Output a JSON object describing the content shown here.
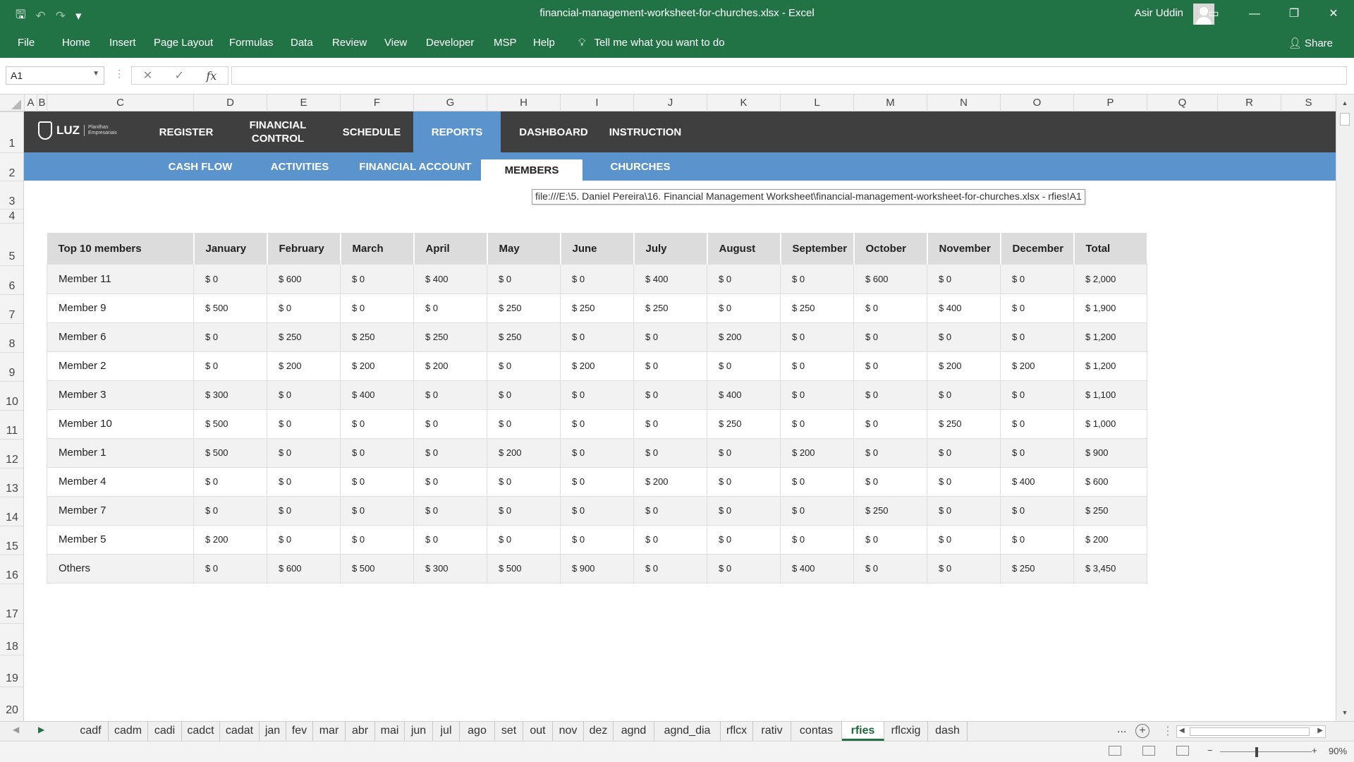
{
  "titlebar": {
    "title": "financial-management-worksheet-for-churches.xlsx  -  Excel",
    "user": "Asir Uddin",
    "qat": {
      "save": "🖫",
      "undo": "↶",
      "redo": "↷",
      "more": "▾"
    },
    "controls": {
      "ribbon_display": "▭",
      "minimize": "—",
      "restore": "❐",
      "close": "✕"
    }
  },
  "ribbon": {
    "tabs": [
      "File",
      "Home",
      "Insert",
      "Page Layout",
      "Formulas",
      "Data",
      "Review",
      "View",
      "Developer",
      "MSP",
      "Help"
    ],
    "tell_me": "Tell me what you want to do",
    "share": "Share"
  },
  "formula_bar": {
    "name_box": "A1",
    "formula": "",
    "cancel_icon": "✕",
    "enter_icon": "✓",
    "fx_label": "fx"
  },
  "columns": [
    "A",
    "B",
    "C",
    "D",
    "E",
    "F",
    "G",
    "H",
    "I",
    "J",
    "K",
    "L",
    "M",
    "N",
    "O",
    "P",
    "Q",
    "R",
    "S"
  ],
  "rows": [
    "1",
    "2",
    "3",
    "4",
    "5",
    "6",
    "7",
    "8",
    "9",
    "10",
    "11",
    "12",
    "13",
    "14",
    "15",
    "16",
    "17",
    "18",
    "19",
    "20"
  ],
  "nav": {
    "logo_brand": "LUZ",
    "logo_sub_1": "Planilhas",
    "logo_sub_2": "Empresariais",
    "items": [
      "REGISTER",
      "FINANCIAL\nCONTROL",
      "SCHEDULE",
      "REPORTS",
      "DASHBOARD",
      "INSTRUCTION"
    ],
    "active_item": "REPORTS",
    "subitems": [
      "CASH FLOW",
      "ACTIVITIES",
      "FINANCIAL ACCOUNT",
      "MEMBERS",
      "CHURCHES"
    ],
    "active_subitem": "MEMBERS",
    "accent_color": "#5b93cc",
    "bar_color": "#3f3f3f"
  },
  "tooltip": "file:///E:\\5. Daniel Pereira\\16. Financial Management Worksheet\\financial-management-worksheet-for-churches.xlsx - rfies!A1",
  "table": {
    "headers": [
      "Top 10 members",
      "January",
      "February",
      "March",
      "April",
      "May",
      "June",
      "July",
      "August",
      "September",
      "October",
      "November",
      "December",
      "Total"
    ],
    "rows": [
      [
        "Member 11",
        "$ 0",
        "$ 600",
        "$ 0",
        "$ 400",
        "$ 0",
        "$ 0",
        "$ 400",
        "$ 0",
        "$ 0",
        "$ 600",
        "$ 0",
        "$ 0",
        "$ 2,000"
      ],
      [
        "Member 9",
        "$ 500",
        "$ 0",
        "$ 0",
        "$ 0",
        "$ 250",
        "$ 250",
        "$ 250",
        "$ 0",
        "$ 250",
        "$ 0",
        "$ 400",
        "$ 0",
        "$ 1,900"
      ],
      [
        "Member 6",
        "$ 0",
        "$ 250",
        "$ 250",
        "$ 250",
        "$ 250",
        "$ 0",
        "$ 0",
        "$ 200",
        "$ 0",
        "$ 0",
        "$ 0",
        "$ 0",
        "$ 1,200"
      ],
      [
        "Member 2",
        "$ 0",
        "$ 200",
        "$ 200",
        "$ 200",
        "$ 0",
        "$ 200",
        "$ 0",
        "$ 0",
        "$ 0",
        "$ 0",
        "$ 200",
        "$ 200",
        "$ 1,200"
      ],
      [
        "Member 3",
        "$ 300",
        "$ 0",
        "$ 400",
        "$ 0",
        "$ 0",
        "$ 0",
        "$ 0",
        "$ 400",
        "$ 0",
        "$ 0",
        "$ 0",
        "$ 0",
        "$ 1,100"
      ],
      [
        "Member 10",
        "$ 500",
        "$ 0",
        "$ 0",
        "$ 0",
        "$ 0",
        "$ 0",
        "$ 0",
        "$ 250",
        "$ 0",
        "$ 0",
        "$ 250",
        "$ 0",
        "$ 1,000"
      ],
      [
        "Member 1",
        "$ 500",
        "$ 0",
        "$ 0",
        "$ 0",
        "$ 200",
        "$ 0",
        "$ 0",
        "$ 0",
        "$ 200",
        "$ 0",
        "$ 0",
        "$ 0",
        "$ 900"
      ],
      [
        "Member 4",
        "$ 0",
        "$ 0",
        "$ 0",
        "$ 0",
        "$ 0",
        "$ 0",
        "$ 200",
        "$ 0",
        "$ 0",
        "$ 0",
        "$ 0",
        "$ 400",
        "$ 600"
      ],
      [
        "Member 7",
        "$ 0",
        "$ 0",
        "$ 0",
        "$ 0",
        "$ 0",
        "$ 0",
        "$ 0",
        "$ 0",
        "$ 0",
        "$ 250",
        "$ 0",
        "$ 0",
        "$ 250"
      ],
      [
        "Member 5",
        "$ 200",
        "$ 0",
        "$ 0",
        "$ 0",
        "$ 0",
        "$ 0",
        "$ 0",
        "$ 0",
        "$ 0",
        "$ 0",
        "$ 0",
        "$ 0",
        "$ 200"
      ],
      [
        "Others",
        "$ 0",
        "$ 600",
        "$ 500",
        "$ 300",
        "$ 500",
        "$ 900",
        "$ 0",
        "$ 0",
        "$ 400",
        "$ 0",
        "$ 0",
        "$ 250",
        "$ 3,450"
      ]
    ]
  },
  "sheet_tabs": {
    "tabs": [
      "cadf",
      "cadm",
      "cadi",
      "cadct",
      "cadat",
      "jan",
      "fev",
      "mar",
      "abr",
      "mai",
      "jun",
      "jul",
      "ago",
      "set",
      "out",
      "nov",
      "dez",
      "agnd",
      "agnd_dia",
      "rflcx",
      "rativ",
      "contas",
      "rfies",
      "rflcxig",
      "dash"
    ],
    "active": "rfies",
    "overflow": "...",
    "add": "+"
  },
  "statusbar": {
    "zoom": "90%",
    "zoom_out": "−",
    "zoom_in": "+"
  }
}
